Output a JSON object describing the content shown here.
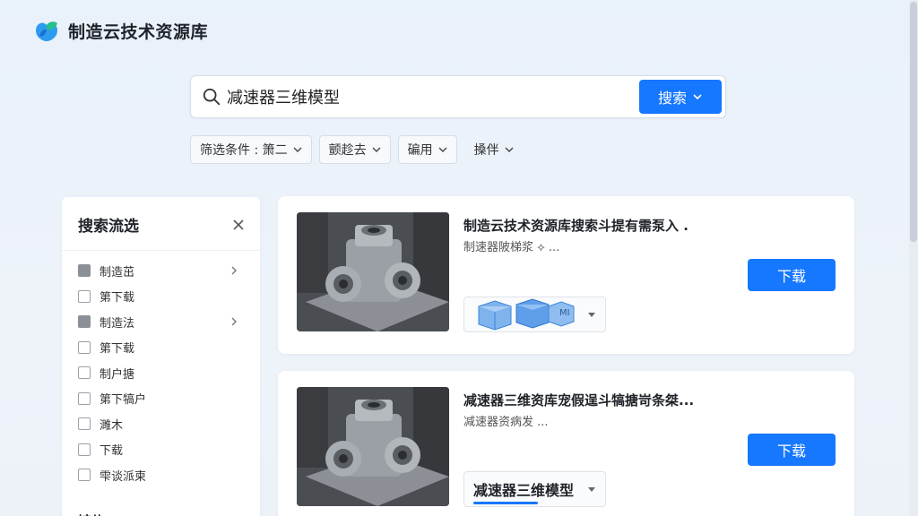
{
  "app": {
    "title": "制造云技术资源库"
  },
  "search": {
    "value": "减速器三维模型",
    "button_label": "搜索"
  },
  "filters": [
    {
      "label": "筛选条件 : 箫二"
    },
    {
      "label": "颤趁去"
    },
    {
      "label": "碥用"
    },
    {
      "label": "搡伴"
    }
  ],
  "sidebar": {
    "title": "搜索流选",
    "items": [
      {
        "label": "制造茁",
        "filled": true,
        "chevron": true
      },
      {
        "label": "第下载",
        "filled": false,
        "chevron": false
      },
      {
        "label": "制造法",
        "filled": true,
        "chevron": true
      },
      {
        "label": "第下载",
        "filled": false,
        "chevron": false
      },
      {
        "label": "制户搪",
        "filled": false,
        "chevron": false
      },
      {
        "label": "第下犒户",
        "filled": false,
        "chevron": false
      },
      {
        "label": "濉木",
        "filled": false,
        "chevron": false
      },
      {
        "label": "下载",
        "filled": false,
        "chevron": false
      },
      {
        "label": "雫谈派柬",
        "filled": false,
        "chevron": false
      }
    ],
    "section_title": "馆约"
  },
  "results": [
    {
      "title": "制造云技术资源库搜索斗提有需泵入 .",
      "subtitle": "制速器陂梯浆 ⟡ ...",
      "download_label": "下载",
      "tag": "MI"
    },
    {
      "title": "减速器三维资库宠假逞斗犒搪岢条桀...",
      "subtitle": "减速器资病发 ...",
      "download_label": "下载",
      "tag": "减速器三维模型"
    }
  ],
  "colors": {
    "primary": "#1677ff",
    "background": "#eaf1fa"
  }
}
